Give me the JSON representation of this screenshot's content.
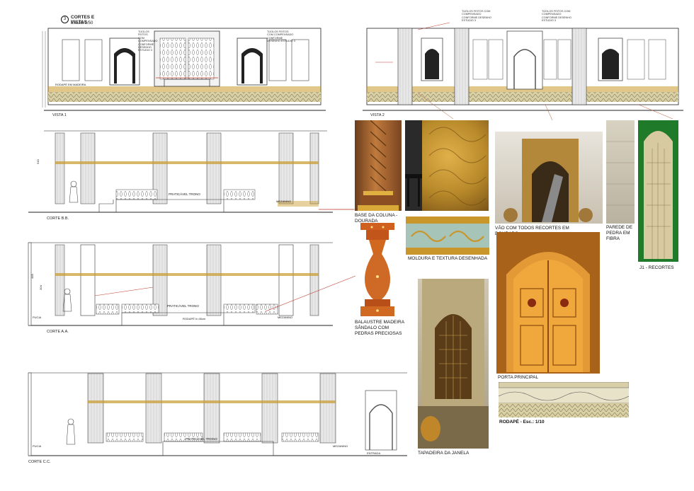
{
  "sheet": {
    "number": "3",
    "title": "CORTES E VISTAS",
    "scale": "Escala 1/50"
  },
  "drawings": {
    "vista1": "VISTA 1",
    "vista2": "VISTA 2",
    "corte_bb": "CORTE B.B.",
    "corte_aa": "CORTE A.A.",
    "corte_cc": "CORTE C.C."
  },
  "labels": {
    "praticavel_trono": "PRATICÁVEL TRONO",
    "rodape": "RODAPÉ h=40cm",
    "mezanino": "MEZANINO",
    "pucia": "PUCIA",
    "entrada": "ENTRADA",
    "rodape_madeira": "RODAPÉ EM MADEIRA",
    "revestimento_note": "TIJOLOS FEITOS COM COMPENSADO CONFORME DESENHO ESTUDIO 3",
    "dim_540": "540",
    "dim_449": "449",
    "dim_304": "304"
  },
  "photos": {
    "base_coluna": "BASE DA COLUNA - DOURADA",
    "moldura": "MOLDURA E TEXTURA DESENHADA",
    "vao": "VÃO COM TODOS RECORTES EM DOURADO",
    "parede": "PAREDE DE PEDRA EM FIBRA",
    "j1": "J1 - RECORTES",
    "balaustre": "BALAUSTRE MADEIRA SÂNDALO COM PEDRAS PRECIOSAS",
    "porta": "PORTA PRINCIPAL",
    "rodape_detail": "RODAPÉ - Esc.: 1/10",
    "tapadeira": "TAPADEIRA DA JANELA"
  },
  "colors": {
    "line": "#222222",
    "gold": "#c89a2a",
    "accent_red": "#c0392b",
    "photo_amber": "#d9892a"
  }
}
